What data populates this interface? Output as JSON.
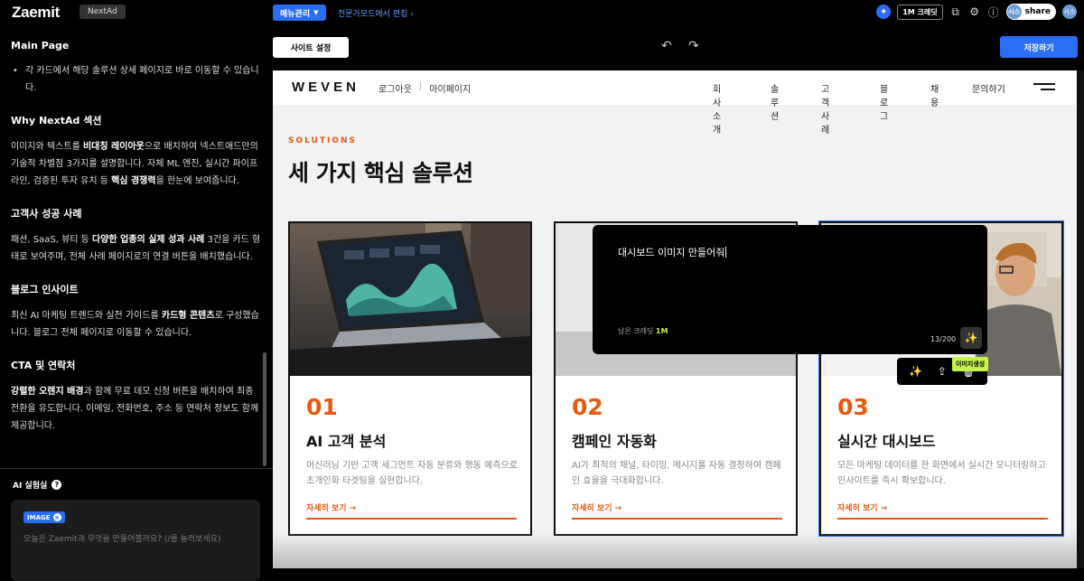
{
  "app": {
    "logo": "Zaemit",
    "badge": "NextAd",
    "menu_button": "메뉴관리",
    "expert_link": "전문가모드에서 편집 ›",
    "credit": "1M 크레딧",
    "share": "share",
    "avatar": "시스"
  },
  "sidebar": {
    "main_title": "Main Page",
    "main_bullet": "각 카드에서 해당 솔루션 상세 페이지로 바로 이동할 수 있습니다.",
    "why_title": "Why NextAd 섹션",
    "why_1": "이미지와 텍스트를 ",
    "why_b1": "비대칭 레이아웃",
    "why_2": "으로 배치하여 넥스트애드만의 기술적 차별점 3가지를 설명합니다. 자체 ML 엔진, 실시간 파이프라인, 검증된 투자 유치 등 ",
    "why_b2": "핵심 경쟁력",
    "why_3": "을 한눈에 보여줍니다.",
    "case_title": "고객사 성공 사례",
    "case_1": "패션, SaaS, 뷰티 등 ",
    "case_b1": "다양한 업종의 실제 성과 사례",
    "case_2": " 3건을 카드 형태로 보여주며, 전체 사례 페이지로의 연결 버튼을 배치했습니다.",
    "blog_title": "블로그 인사이트",
    "blog_1": "최신 AI 마케팅 트렌드와 실전 가이드를 ",
    "blog_b1": "카드형 콘텐츠",
    "blog_2": "로 구성했습니다. 블로그 전체 페이지로 이동할 수 있습니다.",
    "cta_title": "CTA 및 연락처",
    "cta_b1": "강렬한 오렌지 배경",
    "cta_1": "과 함께 무료 데모 신청 버튼을 배치하여 최종 전환을 유도합니다. 이메일, 전화번호, 주소 등 연락처 정보도 함께 제공합니다.",
    "ai_lab": "AI 실험실",
    "chip": "IMAGE",
    "chat_placeholder": "오늘은 Zaemit과 무엇을 만들어볼까요? (/를 눌러보세요)"
  },
  "editor": {
    "site_settings": "사이트 설정",
    "save": "저장하기"
  },
  "site": {
    "brand": "WEVEN",
    "logout": "로그아웃",
    "mypage": "마이페이지",
    "nav": [
      "회사소개",
      "솔루션",
      "고객사례",
      "블로그",
      "채용",
      "문의하기"
    ],
    "section_label": "SOLUTIONS",
    "section_title": "세 가지 핵심 솔루션",
    "cards": [
      {
        "num": "01",
        "title": "AI 고객 분석",
        "desc": "머신러닝 기반 고객 세그먼트 자동 분류와 행동 예측으로 초개인화 타겟팅을 실현합니다.",
        "more": "자세히 보기 →"
      },
      {
        "num": "02",
        "title": "캠페인 자동화",
        "desc": "AI가 최적의 채널, 타이밍, 메시지를 자동 결정하여 캠페인 효율을 극대화합니다.",
        "more": "자세히 보기 →"
      },
      {
        "num": "03",
        "title": "실시간 대시보드",
        "desc": "모든 마케팅 데이터를 한 화면에서 실시간 모니터링하고 인사이트를 즉시 확보합니다.",
        "more": "자세히 보기 →"
      }
    ]
  },
  "prompt": {
    "text": "대시보드 이미지 만들어줘",
    "remaining_label": "남은 크레딧",
    "remaining_value": "1M",
    "counter": "13/200",
    "tooltip": "이미지생성"
  }
}
